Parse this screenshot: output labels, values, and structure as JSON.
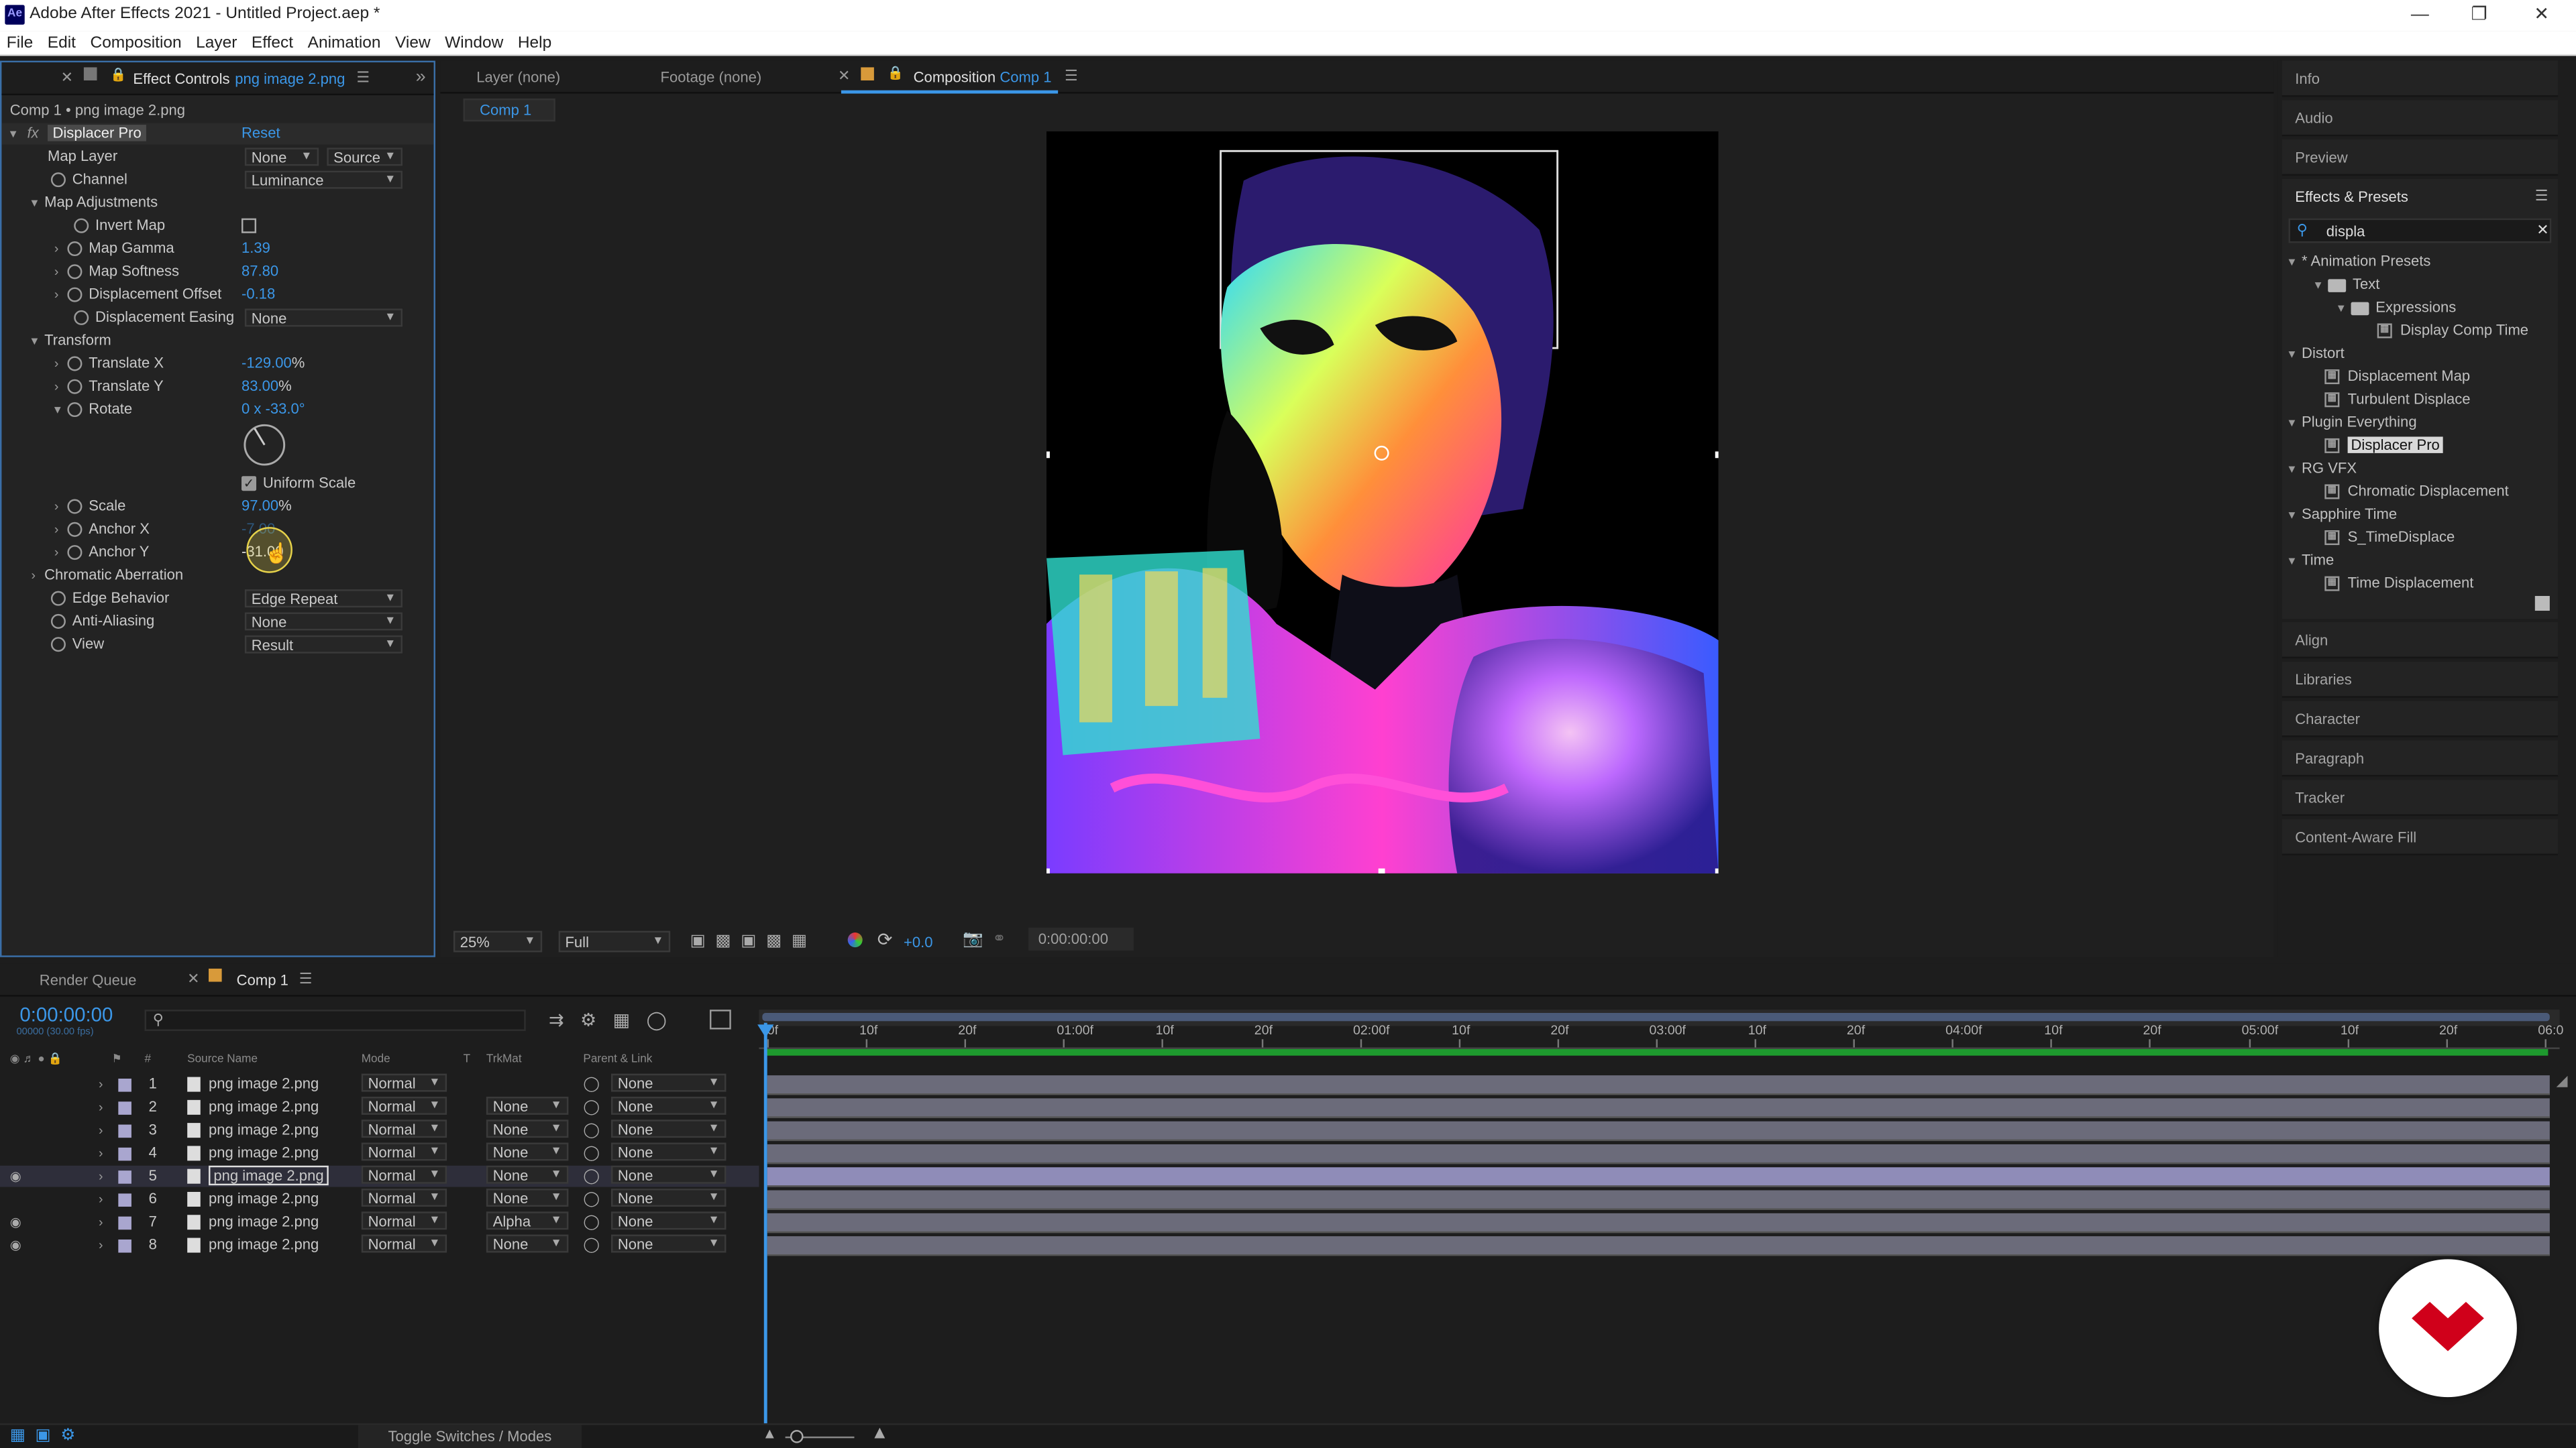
{
  "window": {
    "title": "Adobe After Effects 2021 - Untitled Project.aep *",
    "app_icon": "Ae",
    "controls": [
      "minimize-icon",
      "restore-icon",
      "close-icon"
    ]
  },
  "menu": [
    "File",
    "Edit",
    "Composition",
    "Layer",
    "Effect",
    "Animation",
    "View",
    "Window",
    "Help"
  ],
  "effect_controls": {
    "tab_label": "Effect Controls",
    "tab_layer": "png image 2.png",
    "breadcrumb": "Comp 1 • png image 2.png",
    "effect_name": "Displacer Pro",
    "reset": "Reset",
    "map_layer": {
      "label": "Map Layer",
      "value": "None",
      "source": "Source"
    },
    "channel": {
      "label": "Channel",
      "value": "Luminance"
    },
    "map_adjustments": "Map Adjustments",
    "invert_map": "Invert Map",
    "map_gamma": {
      "label": "Map Gamma",
      "value": "1.39"
    },
    "map_softness": {
      "label": "Map Softness",
      "value": "87.80"
    },
    "disp_offset": {
      "label": "Displacement Offset",
      "value": "-0.18"
    },
    "disp_easing": {
      "label": "Displacement Easing",
      "value": "None"
    },
    "transform": "Transform",
    "translate_x": {
      "label": "Translate X",
      "value": "-129.00",
      "unit": "%"
    },
    "translate_y": {
      "label": "Translate Y",
      "value": "83.00",
      "unit": "%"
    },
    "rotate": {
      "label": "Rotate",
      "value": "0 x -33.0°"
    },
    "uniform_scale": "Uniform Scale",
    "scale": {
      "label": "Scale",
      "value": "97.00",
      "unit": "%"
    },
    "anchor_x": {
      "label": "Anchor X",
      "value": "-7.00"
    },
    "anchor_y": {
      "label": "Anchor Y",
      "value": "-31.00"
    },
    "chromatic": "Chromatic Aberration",
    "edge_behavior": {
      "label": "Edge Behavior",
      "value": "Edge Repeat"
    },
    "anti_aliasing": {
      "label": "Anti-Aliasing",
      "value": "None"
    },
    "view": {
      "label": "View",
      "value": "Result"
    }
  },
  "viewer_tabs": {
    "layer": "Layer",
    "layer_val": "(none)",
    "footage": "Footage",
    "footage_val": "(none)",
    "comp": "Composition",
    "comp_val": "Comp 1",
    "comp_chip": "Comp 1"
  },
  "viewer_bar": {
    "zoom": "25%",
    "quality": "Full",
    "exposure": "+0.0",
    "time": "0:00:00:00"
  },
  "right_panels": {
    "top": [
      "Info",
      "Audio",
      "Preview"
    ],
    "effects_title": "Effects & Presets",
    "search": "displa",
    "bottom": [
      "Align",
      "Libraries",
      "Character",
      "Paragraph",
      "Tracker",
      "Content-Aware Fill"
    ]
  },
  "effects_tree": {
    "animation_presets": "* Animation Presets",
    "text": "Text",
    "expressions": "Expressions",
    "display_comp_time": "Display Comp Time",
    "distort": "Distort",
    "displacement_map": "Displacement Map",
    "turbulent_displace": "Turbulent Displace",
    "plugin_everything": "Plugin Everything",
    "displacer_pro": "Displacer Pro",
    "rg_vfx": "RG VFX",
    "chromatic_displacement": "Chromatic Displacement",
    "sapphire_time": "Sapphire Time",
    "s_timedisplace": "S_TimeDisplace",
    "time": "Time",
    "time_displacement": "Time Displacement"
  },
  "timeline": {
    "render_queue": "Render Queue",
    "comp_tab": "Comp 1",
    "timecode": "0:00:00:00",
    "fps": "00000 (30.00 fps)",
    "headers": {
      "hash": "#",
      "source": "Source Name",
      "mode": "Mode",
      "t": "T",
      "trkmat": "TrkMat",
      "parent": "Parent & Link"
    },
    "layers": [
      {
        "num": "1",
        "name": "png image 2.png",
        "mode": "Normal",
        "trk": "",
        "parent": "None",
        "eye": false
      },
      {
        "num": "2",
        "name": "png image 2.png",
        "mode": "Normal",
        "trk": "None",
        "parent": "None",
        "eye": false
      },
      {
        "num": "3",
        "name": "png image 2.png",
        "mode": "Normal",
        "trk": "None",
        "parent": "None",
        "eye": false
      },
      {
        "num": "4",
        "name": "png image 2.png",
        "mode": "Normal",
        "trk": "None",
        "parent": "None",
        "eye": false
      },
      {
        "num": "5",
        "name": "png image 2.png",
        "mode": "Normal",
        "trk": "None",
        "parent": "None",
        "eye": true
      },
      {
        "num": "6",
        "name": "png image 2.png",
        "mode": "Normal",
        "trk": "None",
        "parent": "None",
        "eye": false
      },
      {
        "num": "7",
        "name": "png image 2.png",
        "mode": "Normal",
        "trk": "Alpha",
        "parent": "None",
        "eye": true
      },
      {
        "num": "8",
        "name": "png image 2.png",
        "mode": "Normal",
        "trk": "None",
        "parent": "None",
        "eye": true
      }
    ],
    "ruler": [
      "0f",
      "10f",
      "20f",
      "01:00f",
      "10f",
      "20f",
      "02:00f",
      "10f",
      "20f",
      "03:00f",
      "10f",
      "20f",
      "04:00f",
      "10f",
      "20f",
      "05:00f",
      "10f",
      "20f",
      "06:0"
    ],
    "toggle": "Toggle Switches / Modes"
  },
  "colors": {
    "accent": "#3b97e8",
    "bg": "#1d1d1d",
    "panel": "#232323",
    "layer_bar": "#6b6b7a",
    "selected_bar": "#8f8cb8",
    "brand_red": "#d0001a"
  }
}
